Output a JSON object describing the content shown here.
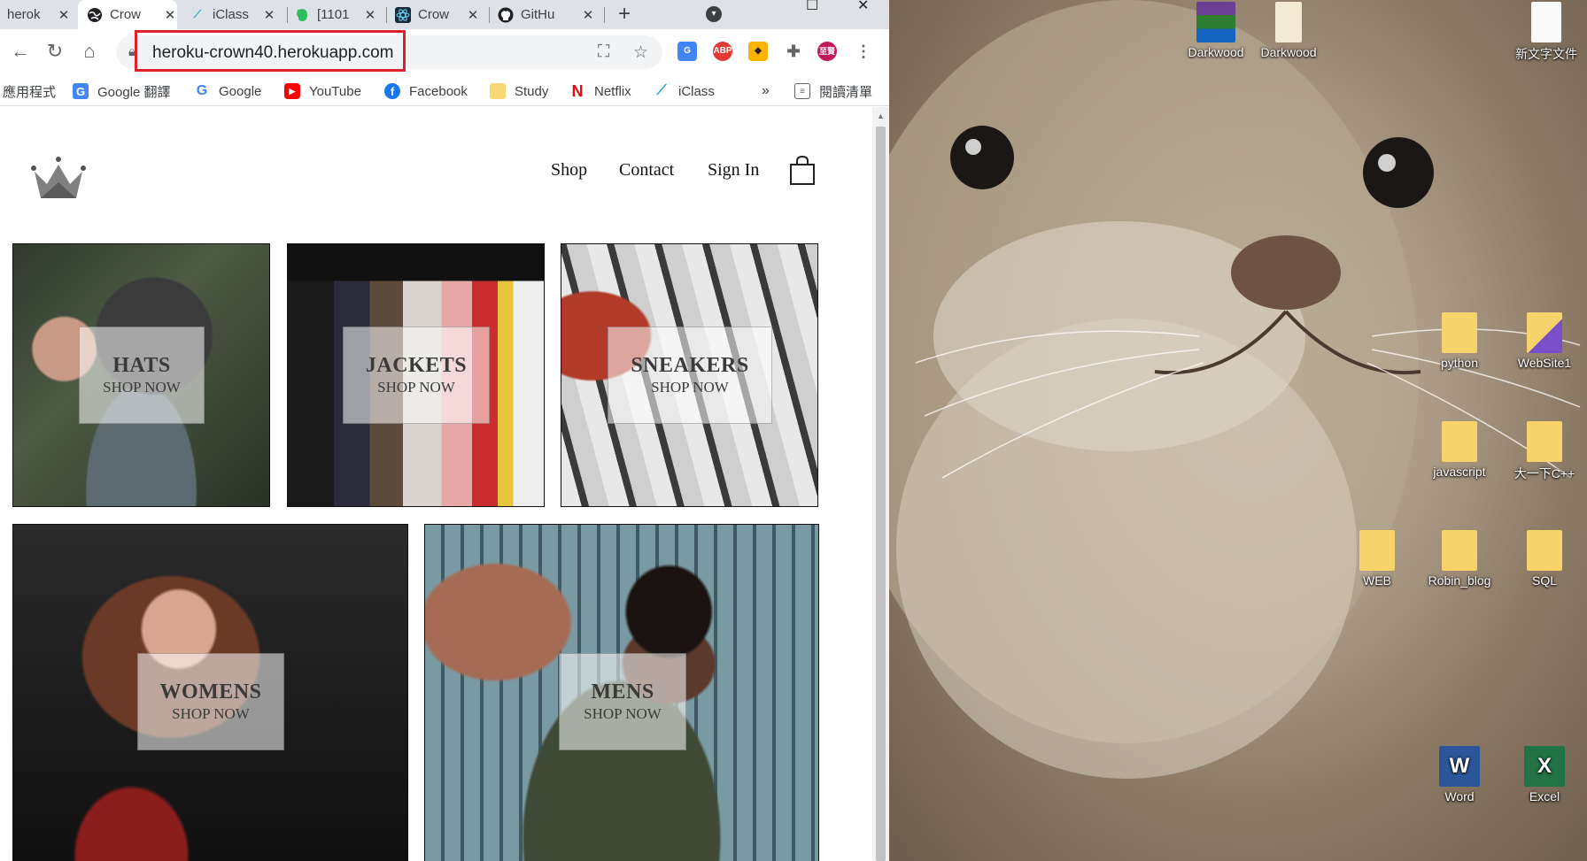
{
  "browser": {
    "tabs": [
      {
        "title": "herok",
        "icon": "heroku-icon",
        "active": false
      },
      {
        "title": "Crow",
        "icon": "globe-icon",
        "active": true
      },
      {
        "title": "iClass",
        "icon": "iclass-icon",
        "active": false
      },
      {
        "title": "[1101",
        "icon": "evernote-icon",
        "active": false
      },
      {
        "title": "Crow",
        "icon": "react-icon",
        "active": false
      },
      {
        "title": "GitHu",
        "icon": "github-icon",
        "active": false
      }
    ],
    "url": "heroku-crown40.herokuapp.com",
    "bookmarks": [
      {
        "label": "應用程式",
        "icon": "apps-grid-icon"
      },
      {
        "label": "Google 翻譯",
        "icon": "google-translate-icon"
      },
      {
        "label": "Google",
        "icon": "google-icon"
      },
      {
        "label": "YouTube",
        "icon": "youtube-icon"
      },
      {
        "label": "Facebook",
        "icon": "facebook-icon"
      },
      {
        "label": "Study",
        "icon": "folder-icon"
      },
      {
        "label": "Netflix",
        "icon": "netflix-icon"
      },
      {
        "label": "iClass",
        "icon": "iclass-icon"
      }
    ],
    "overflow_label": "»",
    "reading_list": "閱讀清單",
    "profile_initials": "至賢"
  },
  "site": {
    "nav": [
      "Shop",
      "Contact",
      "Sign In"
    ],
    "categories": [
      {
        "title": "HATS",
        "subtitle": "SHOP NOW"
      },
      {
        "title": "JACKETS",
        "subtitle": "SHOP NOW"
      },
      {
        "title": "SNEAKERS",
        "subtitle": "SHOP NOW"
      },
      {
        "title": "WOMENS",
        "subtitle": "SHOP NOW"
      },
      {
        "title": "MENS",
        "subtitle": "SHOP NOW"
      }
    ]
  },
  "desktop": {
    "icons": [
      {
        "label": "Darkwood",
        "kind": "winrar-icon"
      },
      {
        "label": "Darkwood",
        "kind": "folder-icon"
      },
      {
        "label": "新文字文件",
        "kind": "text-file-icon"
      },
      {
        "label": "python",
        "kind": "folder-icon"
      },
      {
        "label": "WebSite1",
        "kind": "visual-studio-icon"
      },
      {
        "label": "javascript",
        "kind": "folder-shortcut-icon"
      },
      {
        "label": "大一下C++",
        "kind": "folder-icon"
      },
      {
        "label": "WEB",
        "kind": "folder-icon"
      },
      {
        "label": "Robin_blog",
        "kind": "folder-shortcut-icon"
      },
      {
        "label": "SQL",
        "kind": "folder-icon"
      },
      {
        "label": "Word",
        "kind": "word-icon"
      },
      {
        "label": "Excel",
        "kind": "excel-icon"
      }
    ]
  },
  "colors": {
    "url_highlight": "#e0202a",
    "tabstrip": "#dee1e6",
    "youtube": "#ff0000",
    "facebook": "#1877f2",
    "netflix": "#e50914",
    "word": "#2b579a",
    "excel": "#217346"
  }
}
